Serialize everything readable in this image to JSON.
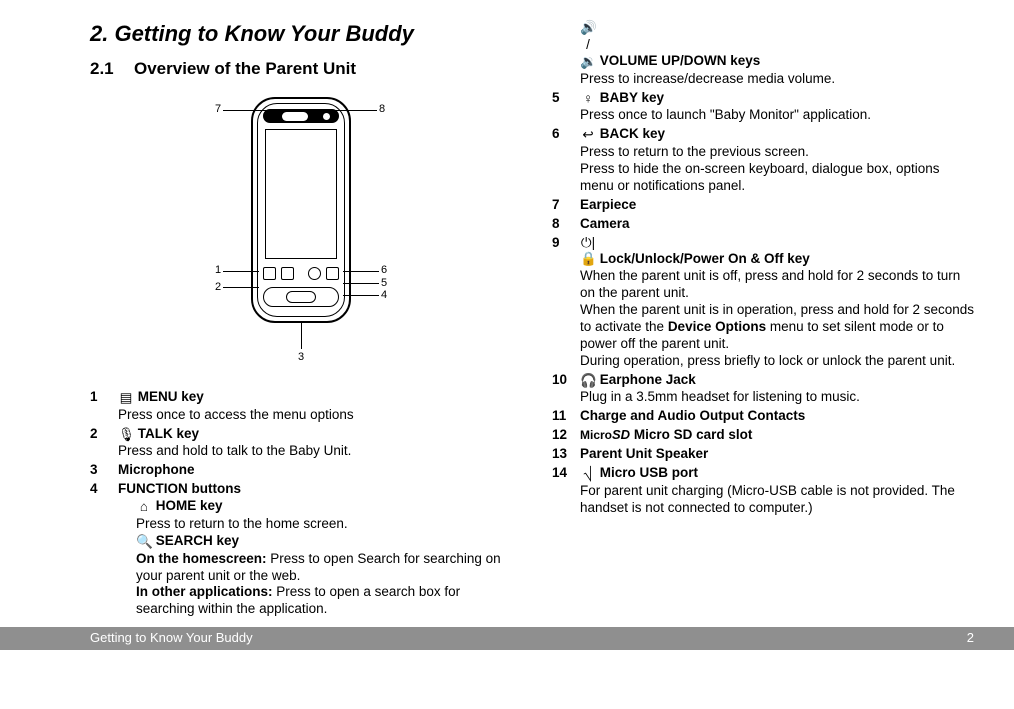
{
  "title": "2.   Getting to Know Your Buddy",
  "subtitle_num": "2.1",
  "subtitle_text": "Overview of the Parent Unit",
  "callouts": {
    "c1": "1",
    "c2": "2",
    "c3": "3",
    "c4": "4",
    "c5": "5",
    "c6": "6",
    "c7": "7",
    "c8": "8"
  },
  "left_items": [
    {
      "n": "1",
      "icon": "▤",
      "label": "MENU key",
      "desc": "Press once to access the menu options"
    },
    {
      "n": "2",
      "icon": "🎙",
      "label": "TALK key",
      "desc": "Press and hold to talk to the Baby Unit."
    },
    {
      "n": "3",
      "icon": "",
      "label": "Microphone",
      "desc": ""
    },
    {
      "n": "4",
      "icon": "",
      "label": "FUNCTION buttons",
      "desc": ""
    }
  ],
  "func_subs": [
    {
      "icon": "⌂",
      "label": "HOME key",
      "desc": "Press to return to the home screen."
    },
    {
      "icon": "🔍",
      "label": "SEARCH key",
      "desc_rich": [
        {
          "b": "On the homescreen:",
          "t": " Press to open Search for searching on your parent unit or the web."
        },
        {
          "b": "In other applications:",
          "t": " Press to open a search box for searching within the application."
        }
      ]
    }
  ],
  "right_top": {
    "icon": "🔊 / 🔉",
    "label": "VOLUME UP/DOWN keys",
    "desc": "Press to increase/decrease media volume."
  },
  "right_items": [
    {
      "n": "5",
      "icon": "♀",
      "label": "BABY key",
      "desc": "Press once to launch \"Baby Monitor\" application."
    },
    {
      "n": "6",
      "icon": "↩",
      "label": "BACK key",
      "desc": "Press to return to the previous screen.",
      "desc2": "Press to hide the on-screen keyboard, dialogue box, options menu or notifications panel."
    },
    {
      "n": "7",
      "icon": "",
      "label": "Earpiece",
      "desc": ""
    },
    {
      "n": "8",
      "icon": "",
      "label": "Camera",
      "desc": ""
    },
    {
      "n": "9",
      "icon": "⏻|🔒",
      "label": "Lock/Unlock/Power On & Off key",
      "desc": "When the parent unit is off, press and hold for 2 seconds to turn on the parent unit.",
      "desc2_rich": [
        {
          "t": "When the parent unit is in operation, press and hold for 2 seconds to activate the "
        },
        {
          "b": "Device Options"
        },
        {
          "t": " menu to set silent mode or to power off the parent unit."
        }
      ],
      "desc3": "During operation, press briefly to lock or unlock the parent unit."
    },
    {
      "n": "10",
      "icon": "🎧",
      "label": "Earphone Jack",
      "desc": "Plug in a 3.5mm headset for listening to music."
    },
    {
      "n": "11",
      "icon": "",
      "label": "Charge and Audio Output Contacts",
      "desc": ""
    },
    {
      "n": "12",
      "icon": "micro",
      "label": "Micro SD card slot",
      "desc": ""
    },
    {
      "n": "13",
      "icon": "",
      "label": "Parent Unit Speaker",
      "desc": ""
    },
    {
      "n": "14",
      "icon": "⎷",
      "label": "Micro USB port",
      "desc": "For parent unit charging (Micro-USB cable is not provided. The handset is not connected to computer.)"
    }
  ],
  "footer_left": "Getting to Know Your Buddy",
  "footer_right": "2"
}
